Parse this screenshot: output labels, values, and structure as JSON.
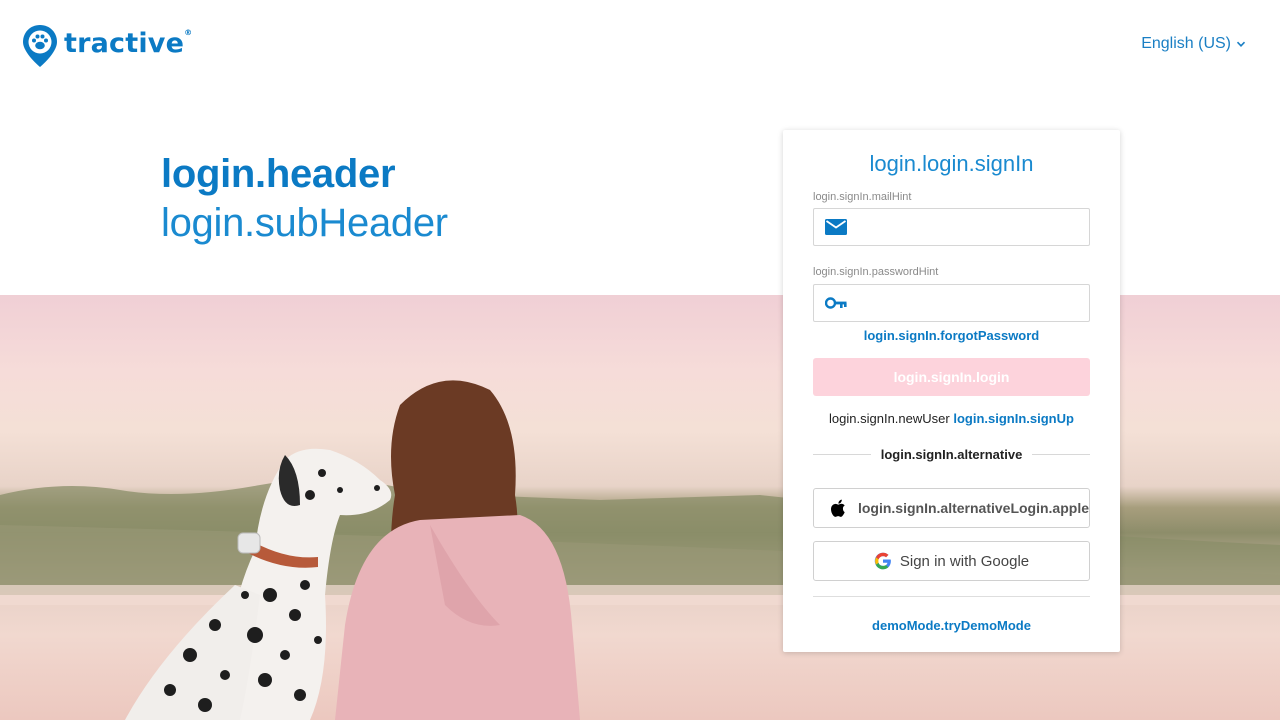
{
  "brand": {
    "name": "tractive",
    "registered": "®",
    "color": "#0b7ac4"
  },
  "language": {
    "label": "English (US)",
    "icon": "chevron-down-icon"
  },
  "hero": {
    "title": "login.header",
    "subtitle": "login.subHeader"
  },
  "form": {
    "title": "login.login.signIn",
    "email": {
      "label": "login.signIn.mailHint",
      "value": "",
      "icon": "mail-icon"
    },
    "password": {
      "label": "login.signIn.passwordHint",
      "value": "",
      "icon": "key-icon"
    },
    "forgot": "login.signIn.forgotPassword",
    "login_button": "login.signIn.login",
    "new_user_text": "login.signIn.newUser",
    "signup_link": "login.signIn.signUp",
    "alternative": "login.signIn.alternative",
    "apple_button": "login.signIn.alternativeLogin.apple",
    "google_button": "Sign in with Google",
    "demo_link": "demoMode.tryDemoMode"
  },
  "colors": {
    "accent": "#0b7ac4",
    "login_button_bg": "#fdd3dc",
    "card_bg": "#ffffff"
  }
}
